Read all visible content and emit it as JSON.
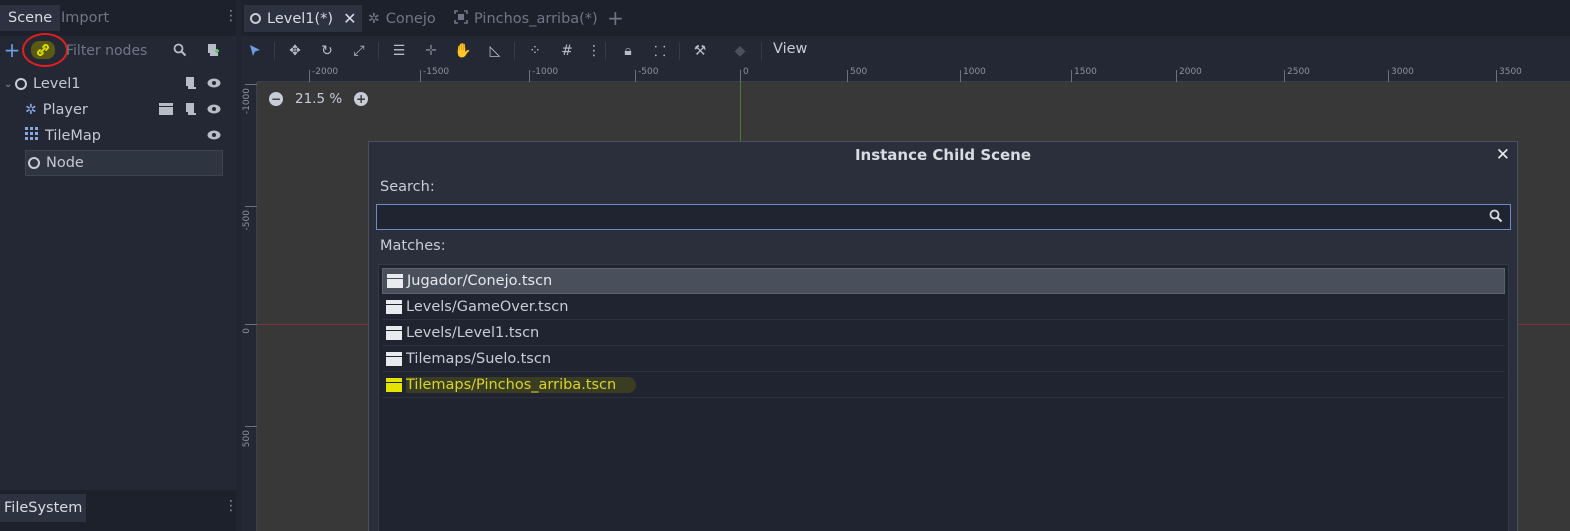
{
  "left_dock": {
    "tabs": [
      {
        "label": "Scene",
        "active": true
      },
      {
        "label": "Import",
        "active": false
      }
    ],
    "filter_placeholder": "Filter nodes",
    "tree": [
      {
        "label": "Level1",
        "icon": "node-circle-icon",
        "expanded": true,
        "icons": [
          "script-icon",
          "eye-icon"
        ]
      },
      {
        "label": "Player",
        "icon": "player-node-icon",
        "icons": [
          "clapboard-icon",
          "script-icon",
          "eye-icon"
        ]
      },
      {
        "label": "TileMap",
        "icon": "tilemap-grid-icon",
        "icons": [
          "eye-icon"
        ]
      },
      {
        "label": "Node",
        "icon": "node-circle-icon",
        "selected": true,
        "icons": []
      }
    ],
    "bottom_tab": "FileSystem"
  },
  "scene_tabs": [
    {
      "label": "Level1(*)",
      "icon": "node-circle-icon",
      "active": true
    },
    {
      "label": "Conejo",
      "icon": "player-node-icon",
      "active": false
    },
    {
      "label": "Pinchos_arriba(*)",
      "icon": "tilemap-frame-icon",
      "active": false
    }
  ],
  "toolbar": {
    "view_label": "View"
  },
  "viewport": {
    "zoom_label": "21.5 %",
    "ruler_top": [
      "-2000",
      "-1500",
      "-1000",
      "-500",
      "0",
      "500",
      "1000",
      "1500",
      "2000",
      "2500",
      "3000",
      "3500"
    ],
    "ruler_left": [
      "-1000",
      "-500",
      "0",
      "500"
    ]
  },
  "dialog": {
    "title": "Instance Child Scene",
    "search_label": "Search:",
    "search_value": "",
    "matches_label": "Matches:",
    "matches": [
      {
        "label": "Jugador/Conejo.tscn",
        "selected": true
      },
      {
        "label": "Levels/GameOver.tscn"
      },
      {
        "label": "Levels/Level1.tscn"
      },
      {
        "label": "Tilemaps/Suelo.tscn"
      },
      {
        "label": "Tilemaps/Pinchos_arriba.tscn",
        "highlighted": true
      }
    ]
  },
  "colors": {
    "annotation_red": "#e02020",
    "highlight_yellow": "#d6d62a",
    "accent_blue": "#6c8bc4"
  }
}
